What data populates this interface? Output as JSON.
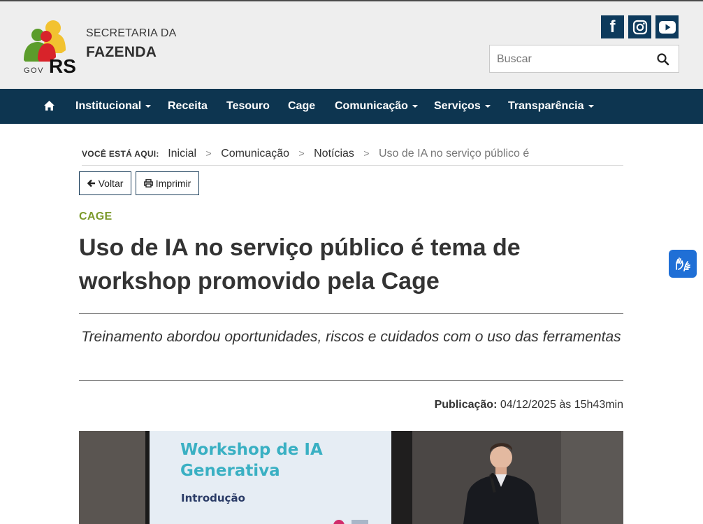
{
  "header": {
    "logo_text_gov": "GOV",
    "logo_text_rs": "RS",
    "org_line1": "SECRETARIA DA",
    "org_line2": "FAZENDA",
    "social": [
      {
        "icon": "facebook-icon",
        "glyph": "f"
      },
      {
        "icon": "instagram-icon"
      },
      {
        "icon": "youtube-icon"
      }
    ],
    "search": {
      "placeholder": "Buscar",
      "value": "",
      "icon": "search-icon"
    }
  },
  "nav": {
    "home_icon": "home-icon",
    "items": [
      {
        "label": "Institucional",
        "dropdown": true
      },
      {
        "label": "Receita",
        "dropdown": false
      },
      {
        "label": "Tesouro",
        "dropdown": false
      },
      {
        "label": "Cage",
        "dropdown": false
      },
      {
        "label": "Comunicação",
        "dropdown": true
      },
      {
        "label": "Serviços",
        "dropdown": true
      },
      {
        "label": "Transparência",
        "dropdown": true
      }
    ]
  },
  "breadcrumb": {
    "label": "VOCÊ ESTÁ AQUI:",
    "items": [
      "Inicial",
      "Comunicação",
      "Notícias"
    ],
    "separator": ">",
    "current": "Uso de IA no serviço público é"
  },
  "actions": {
    "back_label": "Voltar",
    "print_label": "Imprimir"
  },
  "article": {
    "category": "CAGE",
    "title": "Uso de IA no serviço público é tema de workshop promovido pela Cage",
    "subtitle": "Treinamento abordou oportunidades, riscos e cuidados com o uso das ferramentas",
    "publication_label": "Publicação:",
    "publication_value": "04/12/2025 às 15h43min",
    "photo": {
      "slide_title_line1": "Workshop de IA",
      "slide_title_line2": "Generativa",
      "slide_section": "Introdução"
    }
  },
  "accessibility_widget": {
    "icon": "sign-language-hands-icon"
  },
  "colors": {
    "nav_bg": "#0d3550",
    "social_bg": "#0d3a5c",
    "category": "#7c9a2b",
    "accessibility": "#1f6fd6",
    "header_bg": "#eeeeee"
  }
}
